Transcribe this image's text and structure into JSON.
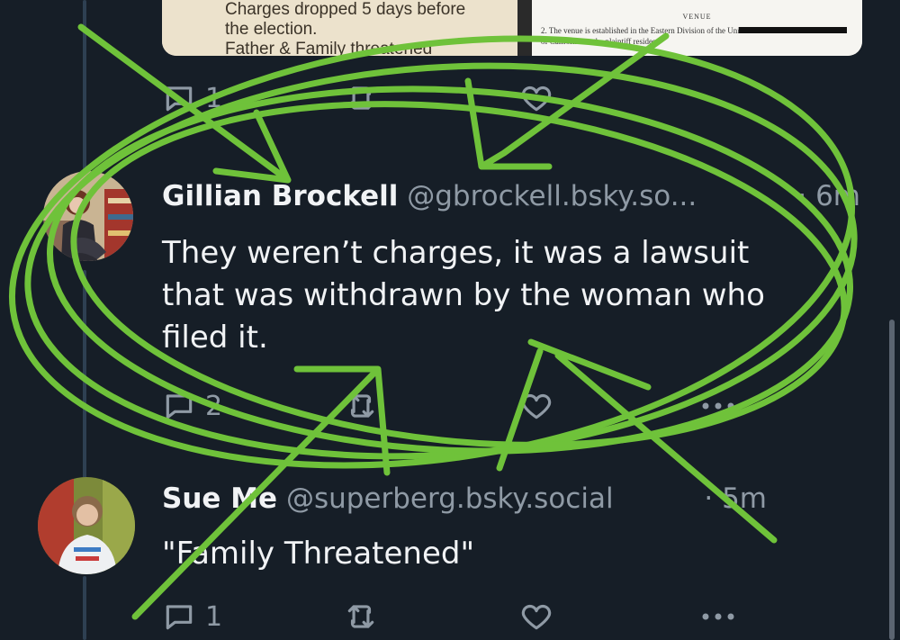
{
  "colors": {
    "background": "#161e27",
    "text": "#f1f3f5",
    "muted": "#8f9aa5",
    "scribble": "#6fc23a"
  },
  "attachment": {
    "left_lines": [
      "Charges dropped 5 days before",
      "the election.",
      "Father & Family threatened"
    ],
    "right_heading": "VENUE",
    "right_line_1": "2.  The venue is established in the Eastern Division of the United States Court Central District",
    "right_line_2": "of California as the plaintiff resides"
  },
  "posts": [
    {
      "reply_count": "1",
      "icons": [
        "reply-icon",
        "repost-icon",
        "like-icon"
      ]
    },
    {
      "display_name": "Gillian Brockell",
      "handle": "@gbrockell.bsky.so...",
      "time": "· 6m",
      "text": "They weren’t charges, it was a lawsuit that was withdrawn by the woman who filed it.",
      "reply_count": "2",
      "icons": [
        "reply-icon",
        "repost-icon",
        "like-icon",
        "more-icon"
      ]
    },
    {
      "display_name": "Sue Me",
      "handle": "@superberg.bsky.social",
      "time": "· 5m",
      "text": "\"Family Threatened\"",
      "reply_count": "1",
      "icons": [
        "reply-icon",
        "repost-icon",
        "like-icon",
        "more-icon"
      ]
    }
  ]
}
